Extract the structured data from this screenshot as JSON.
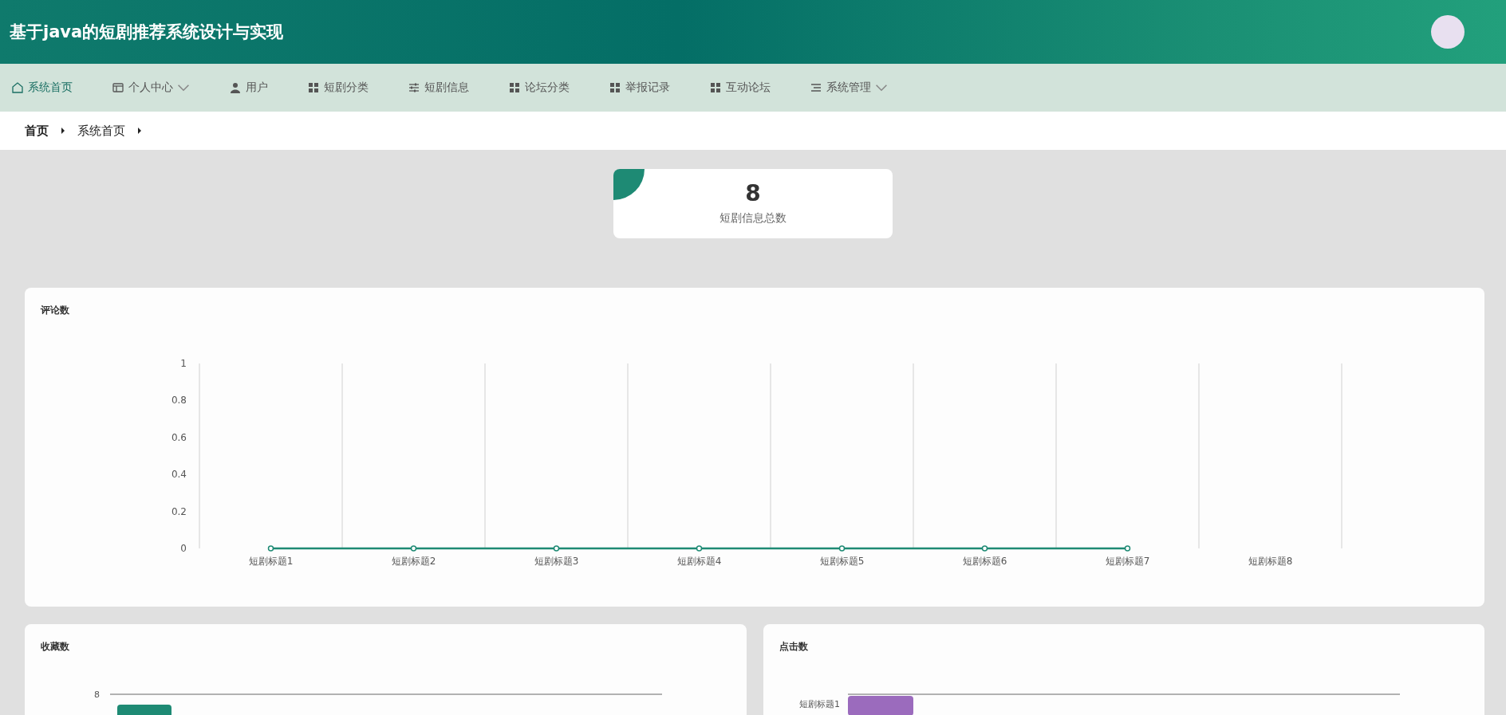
{
  "header": {
    "title": "基于java的短剧推荐系统设计与实现"
  },
  "nav": [
    {
      "label": "系统首页",
      "selected": true,
      "dropdown": false
    },
    {
      "label": "个人中心",
      "selected": false,
      "dropdown": true
    },
    {
      "label": "用户",
      "selected": false,
      "dropdown": false
    },
    {
      "label": "短剧分类",
      "selected": false,
      "dropdown": false
    },
    {
      "label": "短剧信息",
      "selected": false,
      "dropdown": false
    },
    {
      "label": "论坛分类",
      "selected": false,
      "dropdown": false
    },
    {
      "label": "举报记录",
      "selected": false,
      "dropdown": false
    },
    {
      "label": "互动论坛",
      "selected": false,
      "dropdown": false
    },
    {
      "label": "系统管理",
      "selected": false,
      "dropdown": true
    }
  ],
  "breadcrumb": [
    "首页",
    "系统首页"
  ],
  "stat_card": {
    "value": "8",
    "label": "短剧信息总数"
  },
  "comments_panel": {
    "title": "评论数",
    "chart_data": {
      "type": "line",
      "categories": [
        "短剧标题1",
        "短剧标题2",
        "短剧标题3",
        "短剧标题4",
        "短剧标题5",
        "短剧标题6",
        "短剧标题7",
        "短剧标题8"
      ],
      "series": [
        {
          "color": "#1e8a74",
          "marker": "circle",
          "values": [
            0,
            0,
            0,
            0,
            0,
            0,
            0,
            null
          ]
        }
      ],
      "ylim": [
        0,
        1
      ],
      "yticks": [
        0,
        0.2,
        0.4,
        0.6,
        0.8,
        1
      ]
    }
  },
  "favorites_panel": {
    "title": "收藏数",
    "axis_label": "8"
  },
  "clicks_panel": {
    "title": "点击数",
    "category_label": "短剧标题1"
  }
}
